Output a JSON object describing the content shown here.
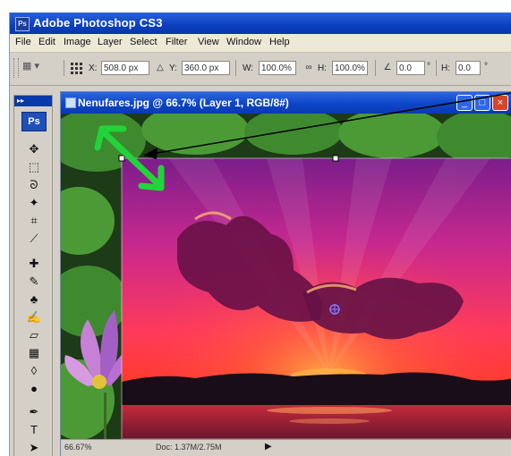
{
  "app": {
    "title": "Adobe Photoshop CS3",
    "logo_text": "Ps"
  },
  "menu": [
    "File",
    "Edit",
    "Image",
    "Layer",
    "Select",
    "Filter",
    "View",
    "Window",
    "Help"
  ],
  "options_bar": {
    "tool_preset": "▦ ▾",
    "x_label": "X:",
    "x_value": "508.0 px",
    "y_label": "Y:",
    "y_value": "360.0 px",
    "w_label": "W:",
    "w_value": "100.0%",
    "h_label": "H:",
    "h_value": "100.0%",
    "angle_value": "0.0",
    "angle_unit": "°",
    "h_skew_label": "H:",
    "h_skew_value": "0.0",
    "v_skew_unit": "°"
  },
  "toolbox": {
    "header": "▸▸",
    "ps_button": "Ps",
    "tools": [
      {
        "name": "move-tool-icon",
        "glyph": "✥"
      },
      {
        "name": "marquee-tool-icon",
        "glyph": "⬚"
      },
      {
        "name": "lasso-tool-icon",
        "glyph": "ᘐ"
      },
      {
        "name": "magic-wand-tool-icon",
        "glyph": "✦"
      },
      {
        "name": "crop-tool-icon",
        "glyph": "⌗"
      },
      {
        "name": "slice-tool-icon",
        "glyph": "⟋"
      },
      {
        "name": "healing-brush-icon",
        "glyph": "✚"
      },
      {
        "name": "brush-tool-icon",
        "glyph": "✎"
      },
      {
        "name": "clone-stamp-icon",
        "glyph": "♣"
      },
      {
        "name": "history-brush-icon",
        "glyph": "✍"
      },
      {
        "name": "eraser-tool-icon",
        "glyph": "▱"
      },
      {
        "name": "gradient-tool-icon",
        "glyph": "▦"
      },
      {
        "name": "blur-tool-icon",
        "glyph": "◊"
      },
      {
        "name": "dodge-tool-icon",
        "glyph": "●"
      },
      {
        "name": "pen-tool-icon",
        "glyph": "✒"
      },
      {
        "name": "type-tool-icon",
        "glyph": "T"
      },
      {
        "name": "path-selection-icon",
        "glyph": "➤"
      }
    ]
  },
  "document": {
    "title": "Nenufares.jpg @ 66.7% (Layer 1, RGB/8#)",
    "minimize": "_",
    "maximize": "□",
    "close": "×",
    "status_zoom": "66.67%",
    "status_doc": "Doc: 1.37M/2.75M",
    "status_arrow": "▶"
  },
  "colors": {
    "xp_blue": "#0b3fbf",
    "annotation_green": "#21d43a",
    "annotation_black": "#000000",
    "leaf_green": "#3f8a2f"
  }
}
